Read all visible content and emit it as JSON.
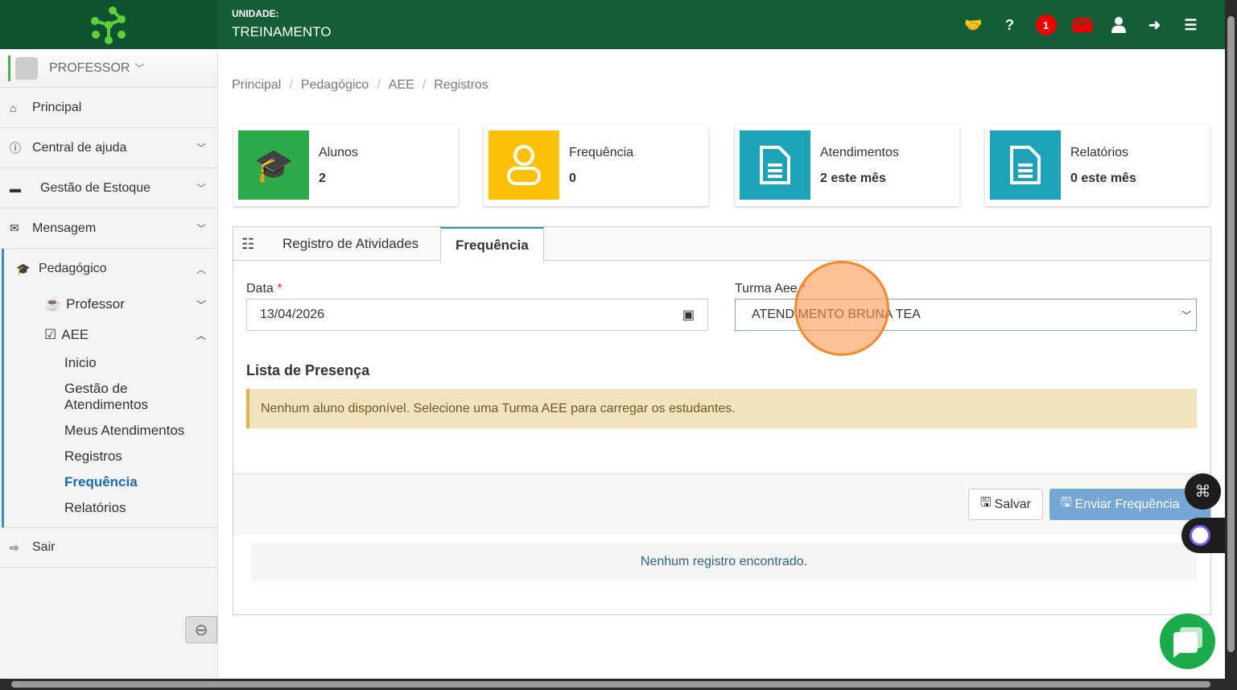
{
  "header": {
    "unit_label": "UNIDADE:",
    "unit_name": "TREINAMENTO",
    "notification_count": "1",
    "help": "?"
  },
  "sidebar": {
    "profile": "PROFESSOR",
    "items": [
      {
        "label": "Principal"
      },
      {
        "label": "Central de ajuda"
      },
      {
        "label": "Gestão de Estoque"
      },
      {
        "label": "Mensagem"
      },
      {
        "label": "Pedagógico"
      }
    ],
    "pedagogico": {
      "professor": "Professor",
      "aee": "AEE",
      "aee_items": [
        "Inicio",
        "Gestão de Atendimentos",
        "Meus Atendimentos",
        "Registros",
        "Frequência",
        "Relatórios"
      ]
    },
    "logout": "Sair"
  },
  "breadcrumb": [
    "Principal",
    "Pedagógico",
    "AEE",
    "Registros"
  ],
  "cards": [
    {
      "title": "Alunos",
      "value": "2",
      "color": "#2eaa4a"
    },
    {
      "title": "Frequência",
      "value": "0",
      "color": "#fbc107"
    },
    {
      "title": "Atendimentos",
      "value": "2 este mês",
      "color": "#1ea2b8"
    },
    {
      "title": "Relatórios",
      "value": "0 este mês",
      "color": "#1ea2b8"
    }
  ],
  "tabs": [
    "Registro de Atividades",
    "Frequência"
  ],
  "form": {
    "date_label": "Data",
    "date_value": "13/04/2026",
    "turma_label": "Turma Aee",
    "turma_value": "ATENDIMENTO BRUNA TEA",
    "required": "*"
  },
  "presence": {
    "title": "Lista de Presença",
    "alert": "Nenhum aluno disponível. Selecione uma Turma AEE para carregar os estudantes."
  },
  "buttons": {
    "save": "Salvar",
    "send": "Enviar Frequência"
  },
  "empty": "Nenhum registro encontrado."
}
